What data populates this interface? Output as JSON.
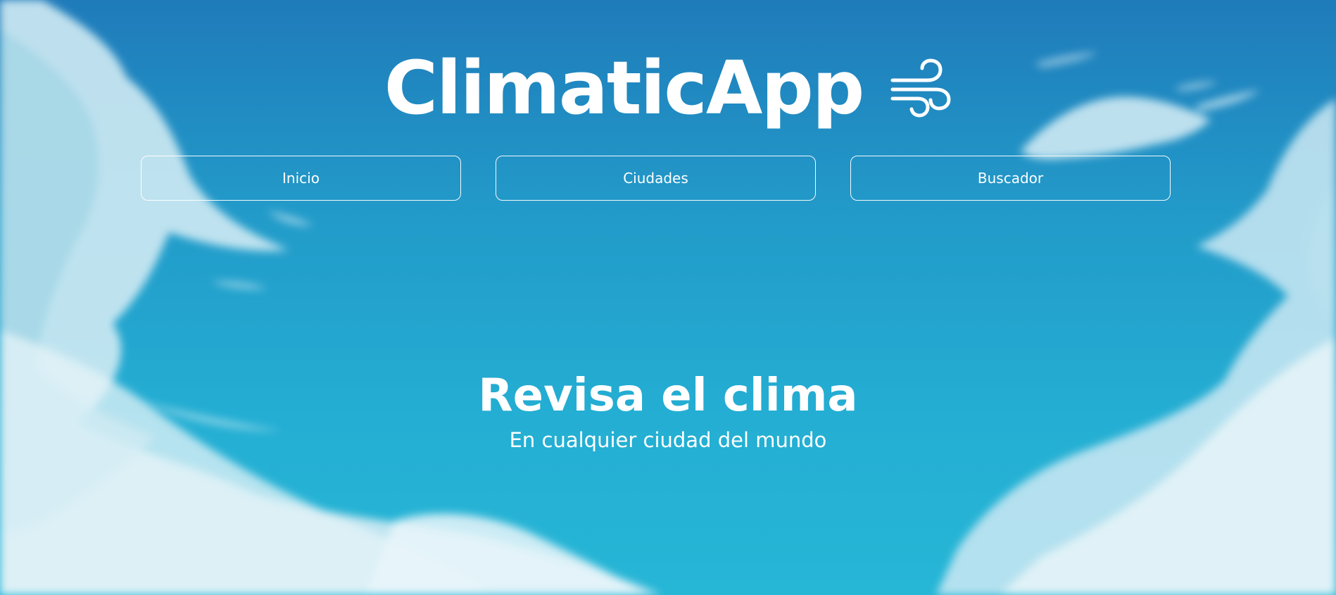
{
  "app": {
    "title": "ClimaticApp",
    "logo_icon": "wind-icon"
  },
  "nav": {
    "items": [
      {
        "label": "Inicio"
      },
      {
        "label": "Ciudades"
      },
      {
        "label": "Buscador"
      }
    ]
  },
  "hero": {
    "title": "Revisa el clima",
    "subtitle": "En cualquier ciudad del mundo"
  },
  "colors": {
    "sky_top": "#1f7bba",
    "sky_bottom": "#26b6d6",
    "text": "#ffffff"
  }
}
